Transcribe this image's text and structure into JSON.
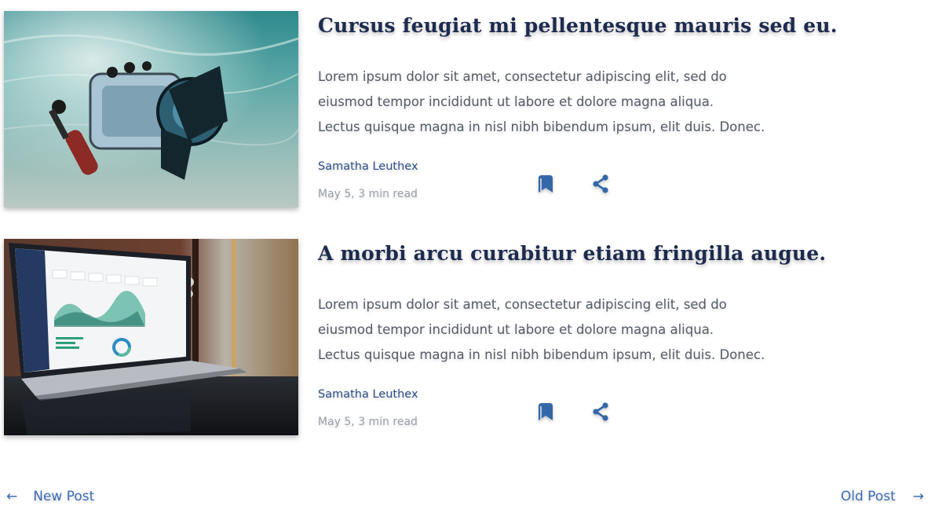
{
  "posts": [
    {
      "title": "Cursus feugiat mi pellentesque mauris sed eu.",
      "excerpt": [
        "Lorem ipsum dolor sit amet, consectetur adipiscing elit, sed do",
        "eiusmod tempor incididunt ut labore et dolore magna aliqua.",
        "Lectus quisque magna in nisl nibh bibendum ipsum, elit duis. Donec."
      ],
      "author": "Samatha Leuthex",
      "meta": "May 5, 3 min read",
      "image_subject": "underwater camera housing on sand"
    },
    {
      "title": "A morbi arcu curabitur etiam fringilla augue.",
      "excerpt": [
        "Lorem ipsum dolor sit amet, consectetur adipiscing elit, sed do",
        "eiusmod tempor incididunt ut labore et dolore magna aliqua.",
        "Lectus quisque magna in nisl nibh bibendum ipsum, elit duis. Donec."
      ],
      "author": "Samatha Leuthex",
      "meta": "May 5, 3 min read",
      "image_subject": "laptop showing analytics dashboard"
    }
  ],
  "icons": {
    "bookmark": "bookmark-icon",
    "share": "share-icon",
    "prev": "arrow-left-icon",
    "next": "arrow-right-icon"
  },
  "pagination": {
    "prev_label": "New Post",
    "next_label": "Old Post",
    "prev_arrow": "←",
    "next_arrow": "→"
  },
  "colors": {
    "title": "#1d2b4e",
    "author": "#2c4e86",
    "icon": "#3467a8",
    "pager": "#3a6db2",
    "meta": "#9aa0aa",
    "body_text": "#555b66"
  }
}
